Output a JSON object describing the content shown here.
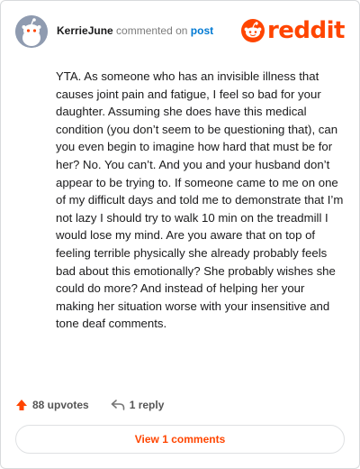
{
  "header": {
    "username": "KerrieJune",
    "action_text": "commented on",
    "post_link": "post",
    "logo_text": "reddit"
  },
  "comment": {
    "text": "YTA. As someone who has an invisible illness that causes joint pain and fatigue, I feel so bad for your daughter. Assuming she does have this medical condition (you don’t seem to be questioning that), can you even begin to imagine how hard that must be for her? No. You can’t. And you and your husband don’t appear to be trying to. If someone came to me on one of my difficult days and told me to demonstrate that I’m not lazy I should try to walk 10 min on the treadmill I would lose my mind. Are you aware that on top of feeling terrible physically she already probably feels bad about this emotionally? She probably wishes she could do more? And instead of helping her your making her situation worse with your insensitive and tone deaf comments."
  },
  "actions": {
    "upvotes_label": "88 upvotes",
    "reply_label": "1 reply"
  },
  "view_comments_label": "View 1 comments",
  "colors": {
    "brand": "#ff4500",
    "link": "#0079d3",
    "text": "#1a1a1b"
  }
}
